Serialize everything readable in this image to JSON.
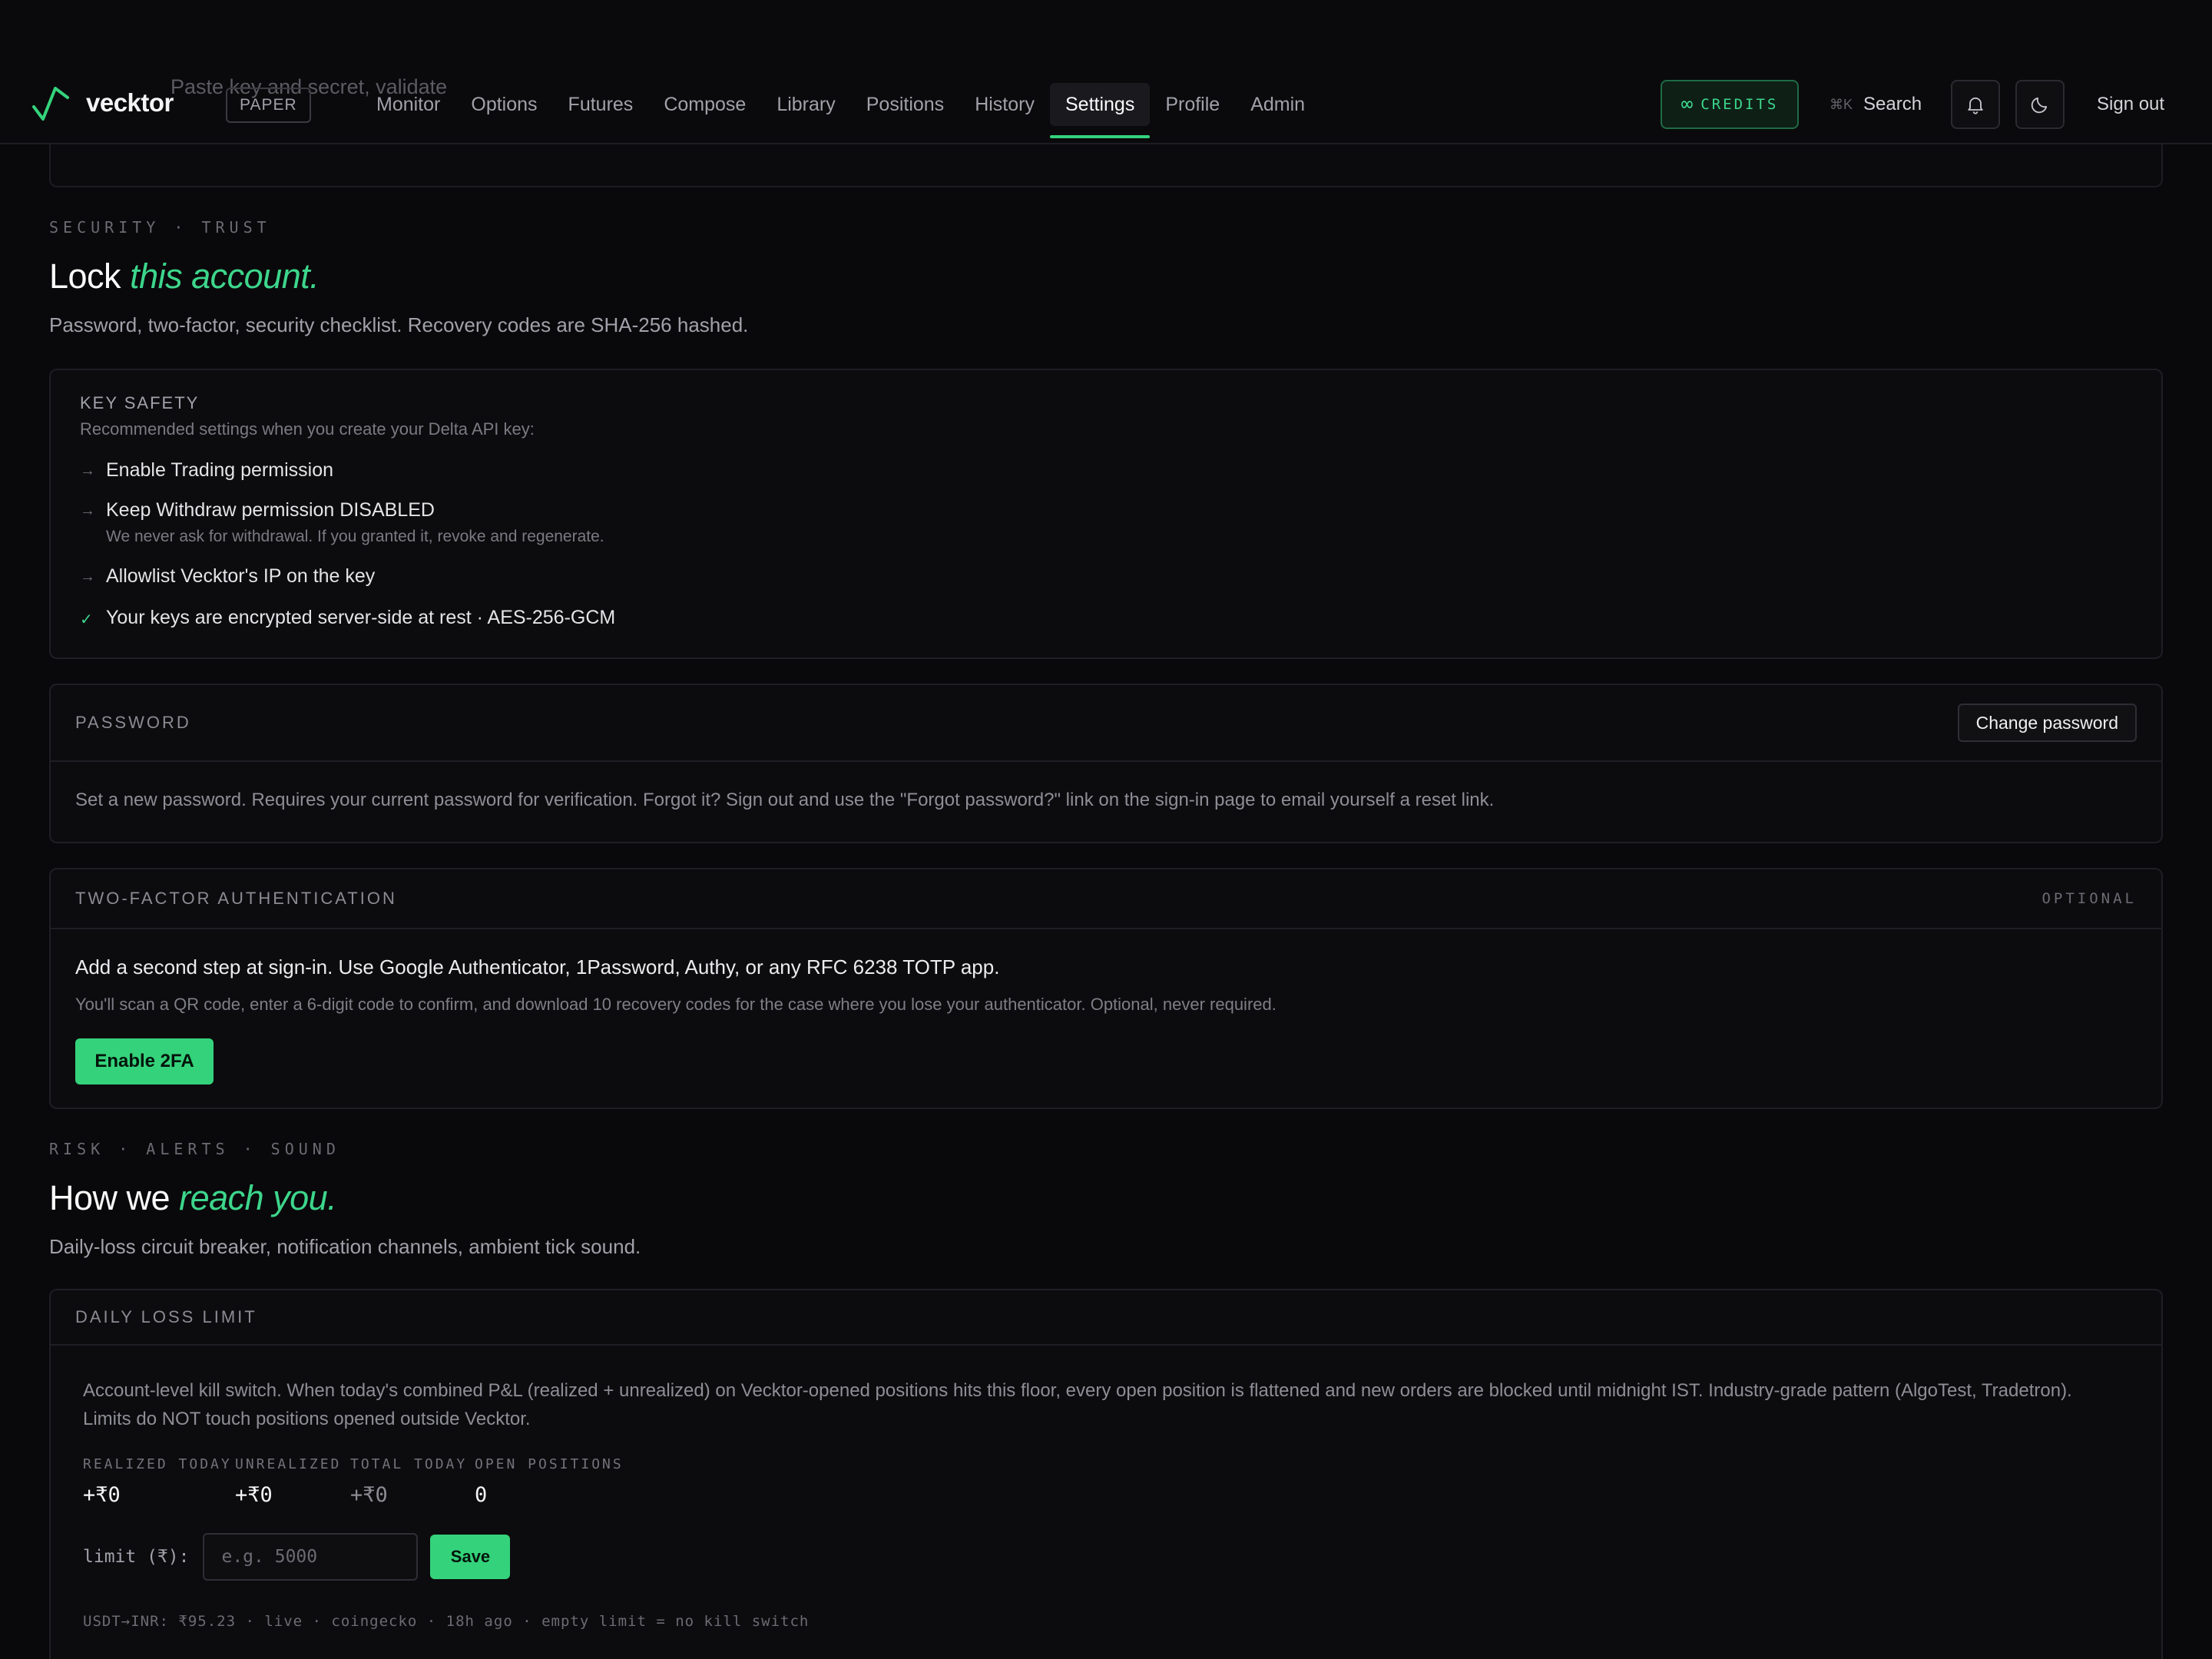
{
  "header": {
    "ghost_text": "Paste key and secret, validate",
    "brand": "vecktor",
    "mode": "PAPER",
    "nav": [
      "Monitor",
      "Options",
      "Futures",
      "Compose",
      "Library",
      "Positions",
      "History",
      "Settings",
      "Profile",
      "Admin"
    ],
    "credits_label": "CREDITS",
    "credits_symbol": "∞",
    "search_kbd": "⌘K",
    "search_label": "Search",
    "signout": "Sign out"
  },
  "security": {
    "eyebrow": "SECURITY · TRUST",
    "title_plain": "Lock",
    "title_accent": "this account.",
    "subtitle": "Password, two-factor, security checklist. Recovery codes are SHA-256 hashed.",
    "key_safety": {
      "title": "KEY SAFETY",
      "subtitle": "Recommended settings when you create your Delta API key:",
      "items": [
        {
          "text": "Enable Trading permission",
          "note": ""
        },
        {
          "text": "Keep Withdraw permission DISABLED",
          "note": "We never ask for withdrawal. If you granted it, revoke and regenerate."
        },
        {
          "text": "Allowlist Vecktor's IP on the key",
          "note": ""
        },
        {
          "text": "Your keys are encrypted server-side at rest · AES-256-GCM",
          "note": ""
        }
      ]
    },
    "password": {
      "label": "PASSWORD",
      "button": "Change password",
      "body": "Set a new password. Requires your current password for verification. Forgot it? Sign out and use the \"Forgot password?\" link on the sign-in page to email yourself a reset link."
    },
    "twofa": {
      "label": "TWO-FACTOR AUTHENTICATION",
      "badge": "OPTIONAL",
      "headline": "Add a second step at sign-in. Use Google Authenticator, 1Password, Authy, or any RFC 6238 TOTP app.",
      "body": "You'll scan a QR code, enter a 6-digit code to confirm, and download 10 recovery codes for the case where you lose your authenticator. Optional, never required.",
      "button": "Enable 2FA"
    }
  },
  "risk": {
    "eyebrow": "RISK · ALERTS · SOUND",
    "title_plain": "How we",
    "title_accent": "reach you.",
    "subtitle": "Daily-loss circuit breaker, notification channels, ambient tick sound.",
    "daily_loss": {
      "label": "DAILY LOSS LIMIT",
      "body_line1": "Account-level kill switch. When today's combined P&L (realized + unrealized) on Vecktor-opened positions hits this floor, every open position is flattened and new orders are blocked until midnight IST. Industry-grade pattern (AlgoTest, Tradetron).",
      "body_line2": "Limits do NOT touch positions opened outside Vecktor.",
      "stats": [
        {
          "label": "REALIZED TODAY",
          "value": "+₹0"
        },
        {
          "label": "UNREALIZED",
          "value": "+₹0"
        },
        {
          "label": "TOTAL TODAY",
          "value": "+₹0"
        },
        {
          "label": "OPEN POSITIONS",
          "value": "0"
        }
      ],
      "limit_label": "limit (₹):",
      "limit_placeholder": "e.g. 5000",
      "save": "Save",
      "footnote": "USDT→INR: ₹95.23 · live · coingecko · 18h ago · empty limit = no kill switch"
    }
  },
  "colors": {
    "accent": "#34d37b",
    "background": "#09090b"
  }
}
